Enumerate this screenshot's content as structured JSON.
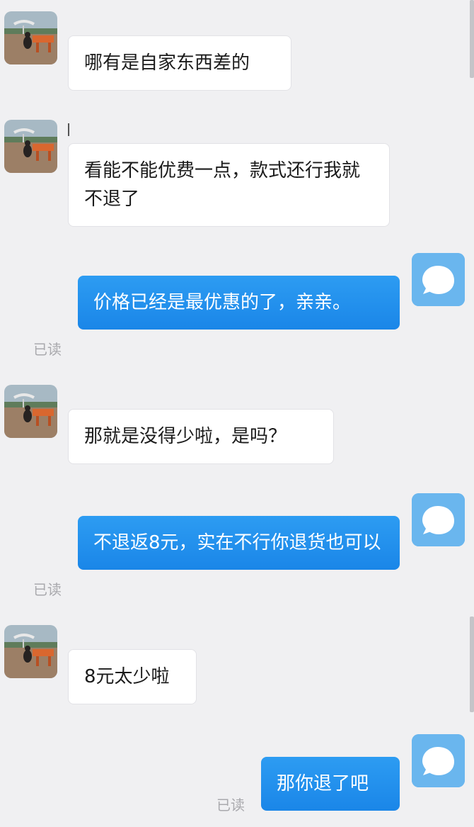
{
  "messages": [
    {
      "side": "in",
      "text": "哪有是自家东西差的"
    },
    {
      "side": "in",
      "text": "看能不能优费一点，款式还行我就不退了"
    },
    {
      "side": "out",
      "text": "价格已经是最优惠的了，亲亲。",
      "status": "已读"
    },
    {
      "side": "in",
      "text": "那就是没得少啦，是吗？"
    },
    {
      "side": "out",
      "text": "不退返8元，实在不行你退货也可以",
      "status": "已读"
    },
    {
      "side": "in",
      "text": "8元太少啦"
    },
    {
      "side": "out",
      "text": "那你退了吧",
      "status": "已读"
    }
  ],
  "icons": {
    "contact_avatar": "dog-photo-avatar",
    "self_avatar": "speech-bubble-avatar"
  },
  "colors": {
    "background": "#f0f0f2",
    "incoming_bubble": "#ffffff",
    "outgoing_bubble": "#1a86e8",
    "read_status": "#a9a9ad",
    "self_avatar": "#6ab6ee"
  }
}
